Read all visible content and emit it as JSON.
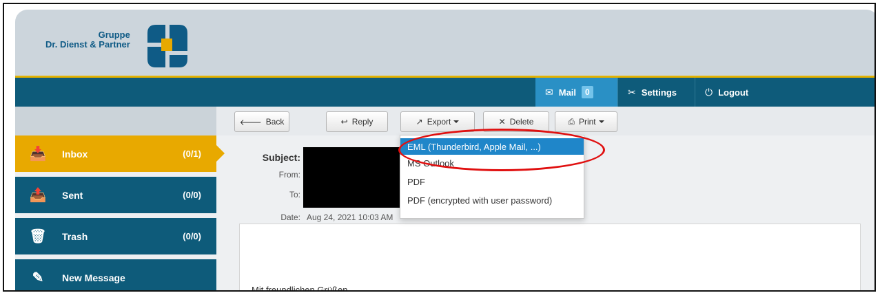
{
  "brand": {
    "line1": "Gruppe",
    "line2": "Dr. Dienst & Partner",
    "colors": {
      "primary": "#0e5b7a",
      "accent": "#e8a900",
      "logo_blue": "#0f5b86"
    }
  },
  "topnav": {
    "mail": {
      "label": "Mail",
      "badge": "0",
      "icon": "envelope-icon"
    },
    "settings": {
      "label": "Settings",
      "icon": "tools-icon"
    },
    "logout": {
      "label": "Logout",
      "icon": "power-icon"
    }
  },
  "toolbar": {
    "back": "Back",
    "reply": "Reply",
    "export": "Export",
    "delete": "Delete",
    "print": "Print"
  },
  "sidebar": {
    "items": [
      {
        "label": "Inbox",
        "count": "(0/1)",
        "icon": "inbox-icon",
        "active": true
      },
      {
        "label": "Sent",
        "count": "(0/0)",
        "icon": "sent-icon"
      },
      {
        "label": "Trash",
        "count": "(0/0)",
        "icon": "trash-icon"
      },
      {
        "label": "New Message",
        "count": "",
        "icon": "compose-icon"
      }
    ]
  },
  "message": {
    "subject_label": "Subject:",
    "from_label": "From:",
    "to_label": "To:",
    "date_label": "Date:",
    "date_value": "Aug 24, 2021 10:03 AM",
    "body": "Mit freundlichen Grüßen"
  },
  "export_menu": {
    "options": [
      "EML (Thunderbird, Apple Mail, ...)",
      "MS Outlook",
      "PDF",
      "PDF (encrypted with user password)"
    ],
    "highlight_color": "#e01010"
  }
}
